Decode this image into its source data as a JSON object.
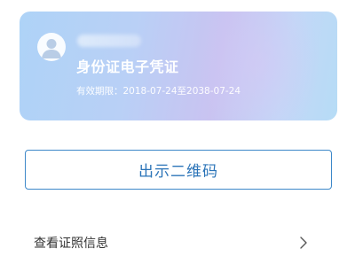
{
  "card": {
    "title": "身份证电子凭证",
    "validity": "有效期限：2018-07-24至2038-07-24",
    "avatar_icon": "user-avatar-icon",
    "name_masked": true
  },
  "actions": {
    "qr_button_label": "出示二维码",
    "view_info_label": "查看证照信息",
    "view_info_icon": "chevron-right-icon"
  },
  "colors": {
    "accent": "#2b74b8",
    "card_gradient_start": "#aed3f7",
    "card_gradient_mid": "#c9c3f1"
  }
}
